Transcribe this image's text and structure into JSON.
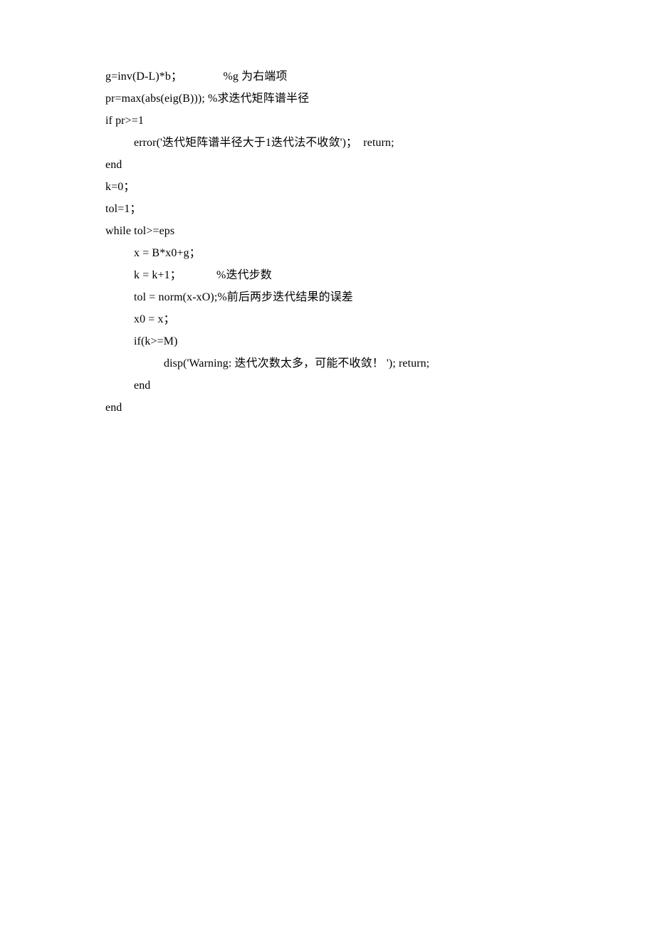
{
  "code": {
    "lines": [
      {
        "indent": 0,
        "text": "g=inv(D-L)*b；              %g 为右端项"
      },
      {
        "indent": 0,
        "text": "pr=max(abs(eig(B))); %求迭代矩阵谱半径"
      },
      {
        "indent": 0,
        "text": "if pr>=1"
      },
      {
        "indent": 1,
        "text": "error('迭代矩阵谱半径大于1迭代法不收敛')；  return;"
      },
      {
        "indent": 0,
        "text": "end"
      },
      {
        "indent": 0,
        "text": "k=0；"
      },
      {
        "indent": 0,
        "text": "tol=1；"
      },
      {
        "indent": 0,
        "text": "while tol>=eps"
      },
      {
        "indent": 1,
        "text": "x = B*x0+g；"
      },
      {
        "indent": 1,
        "text": "k = k+1；            %迭代步数"
      },
      {
        "indent": 1,
        "text": "tol = norm(x-xO);%前后两步迭代结果的误差"
      },
      {
        "indent": 1,
        "text": "x0 = x；"
      },
      {
        "indent": 1,
        "text": "if(k>=M)"
      },
      {
        "indent": 2,
        "text": "disp('Warning: 迭代次数太多，可能不收敛！ '); return;"
      },
      {
        "indent": 1,
        "text": "end"
      },
      {
        "indent": 0,
        "text": "end"
      }
    ]
  }
}
